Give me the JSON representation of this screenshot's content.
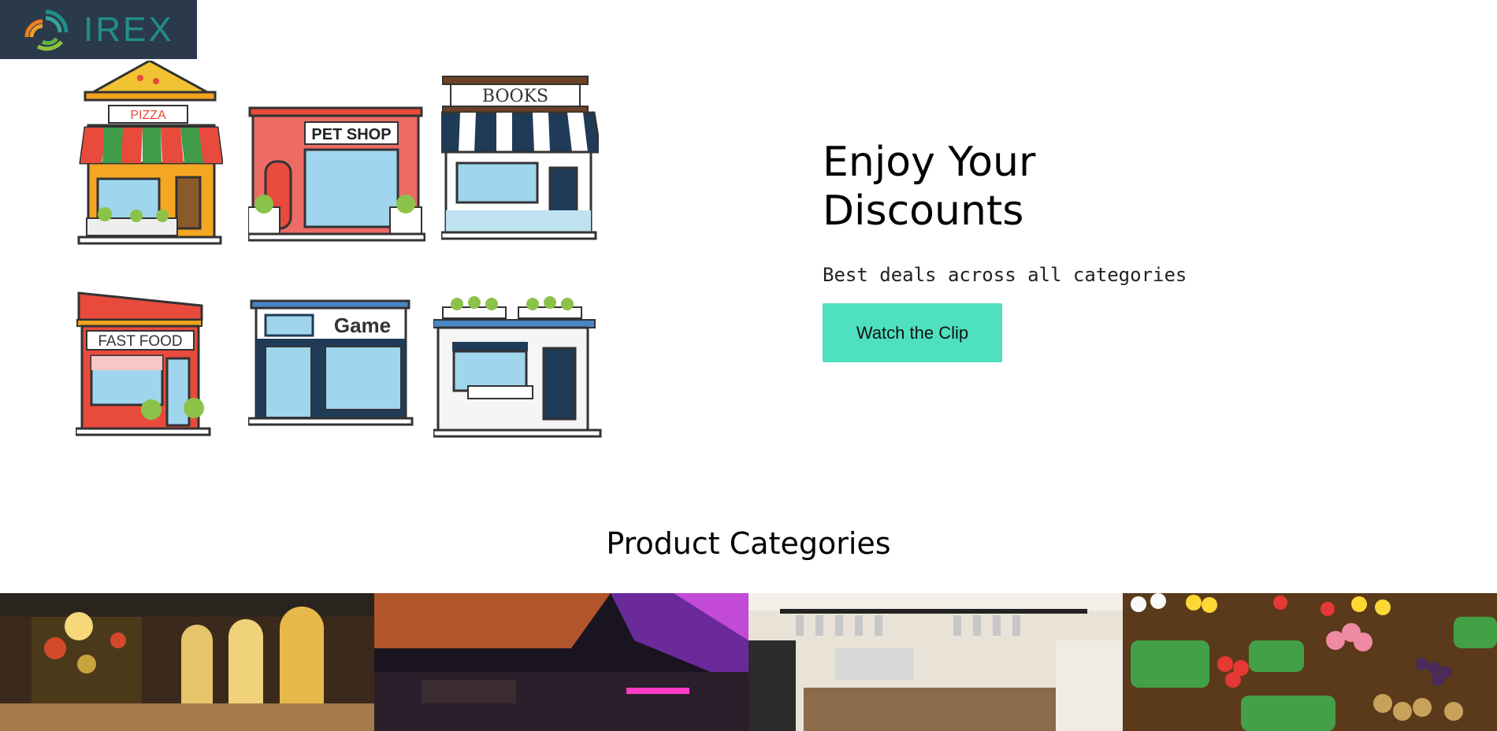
{
  "logo": {
    "text": "IREX"
  },
  "shops": {
    "pizza": "PIZZA",
    "pet": "PET SHOP",
    "books": "BOOKS",
    "fastfood": "FAST FOOD",
    "game": "Game"
  },
  "hero": {
    "title_line1": "Enjoy Your",
    "title_line2": "Discounts",
    "subtitle": "Best deals across all categories",
    "button_label": "Watch the Clip"
  },
  "categories": {
    "title": "Product Categories"
  },
  "colors": {
    "accent": "#4ee0bf",
    "logo_bg": "#2b3a4a",
    "logo_text": "#1f8f8a"
  }
}
